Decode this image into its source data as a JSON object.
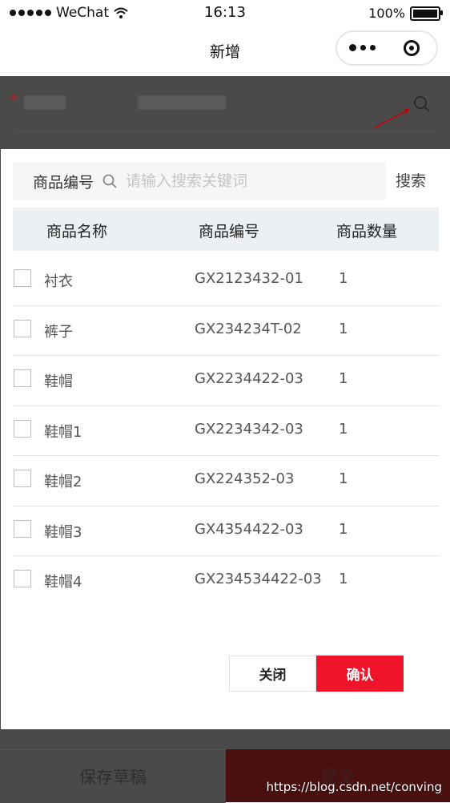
{
  "status_bar": {
    "carrier": "WeChat",
    "time": "16:13",
    "battery": "100%"
  },
  "navbar": {
    "title": "新增"
  },
  "search": {
    "label": "商品编号",
    "placeholder": "请输入搜索关键词",
    "button": "搜索"
  },
  "table": {
    "headers": [
      "商品名称",
      "商品编号",
      "商品数量"
    ],
    "rows": [
      {
        "name": "衬衣",
        "code": "GX2123432-01",
        "qty": "1"
      },
      {
        "name": "裤子",
        "code": "GX234234T-02",
        "qty": "1"
      },
      {
        "name": "鞋帽",
        "code": "GX2234422-03",
        "qty": "1"
      },
      {
        "name": "鞋帽1",
        "code": "GX2234342-03",
        "qty": "1"
      },
      {
        "name": "鞋帽2",
        "code": "GX224352-03",
        "qty": "1"
      },
      {
        "name": "鞋帽3",
        "code": "GX4354422-03",
        "qty": "1"
      },
      {
        "name": "鞋帽4",
        "code": "GX234534422-03",
        "qty": "1"
      }
    ]
  },
  "dialog_actions": {
    "close": "关闭",
    "confirm": "确认"
  },
  "bottom_bar": {
    "draft": "保存草稿",
    "submit": "提交"
  },
  "watermark": "https://blog.csdn.net/conving",
  "background_form": {
    "required_mark": "*"
  },
  "colors": {
    "confirm": "#f0142b",
    "header_bg": "#ecf0f5",
    "search_bg": "#f5f6f8"
  }
}
